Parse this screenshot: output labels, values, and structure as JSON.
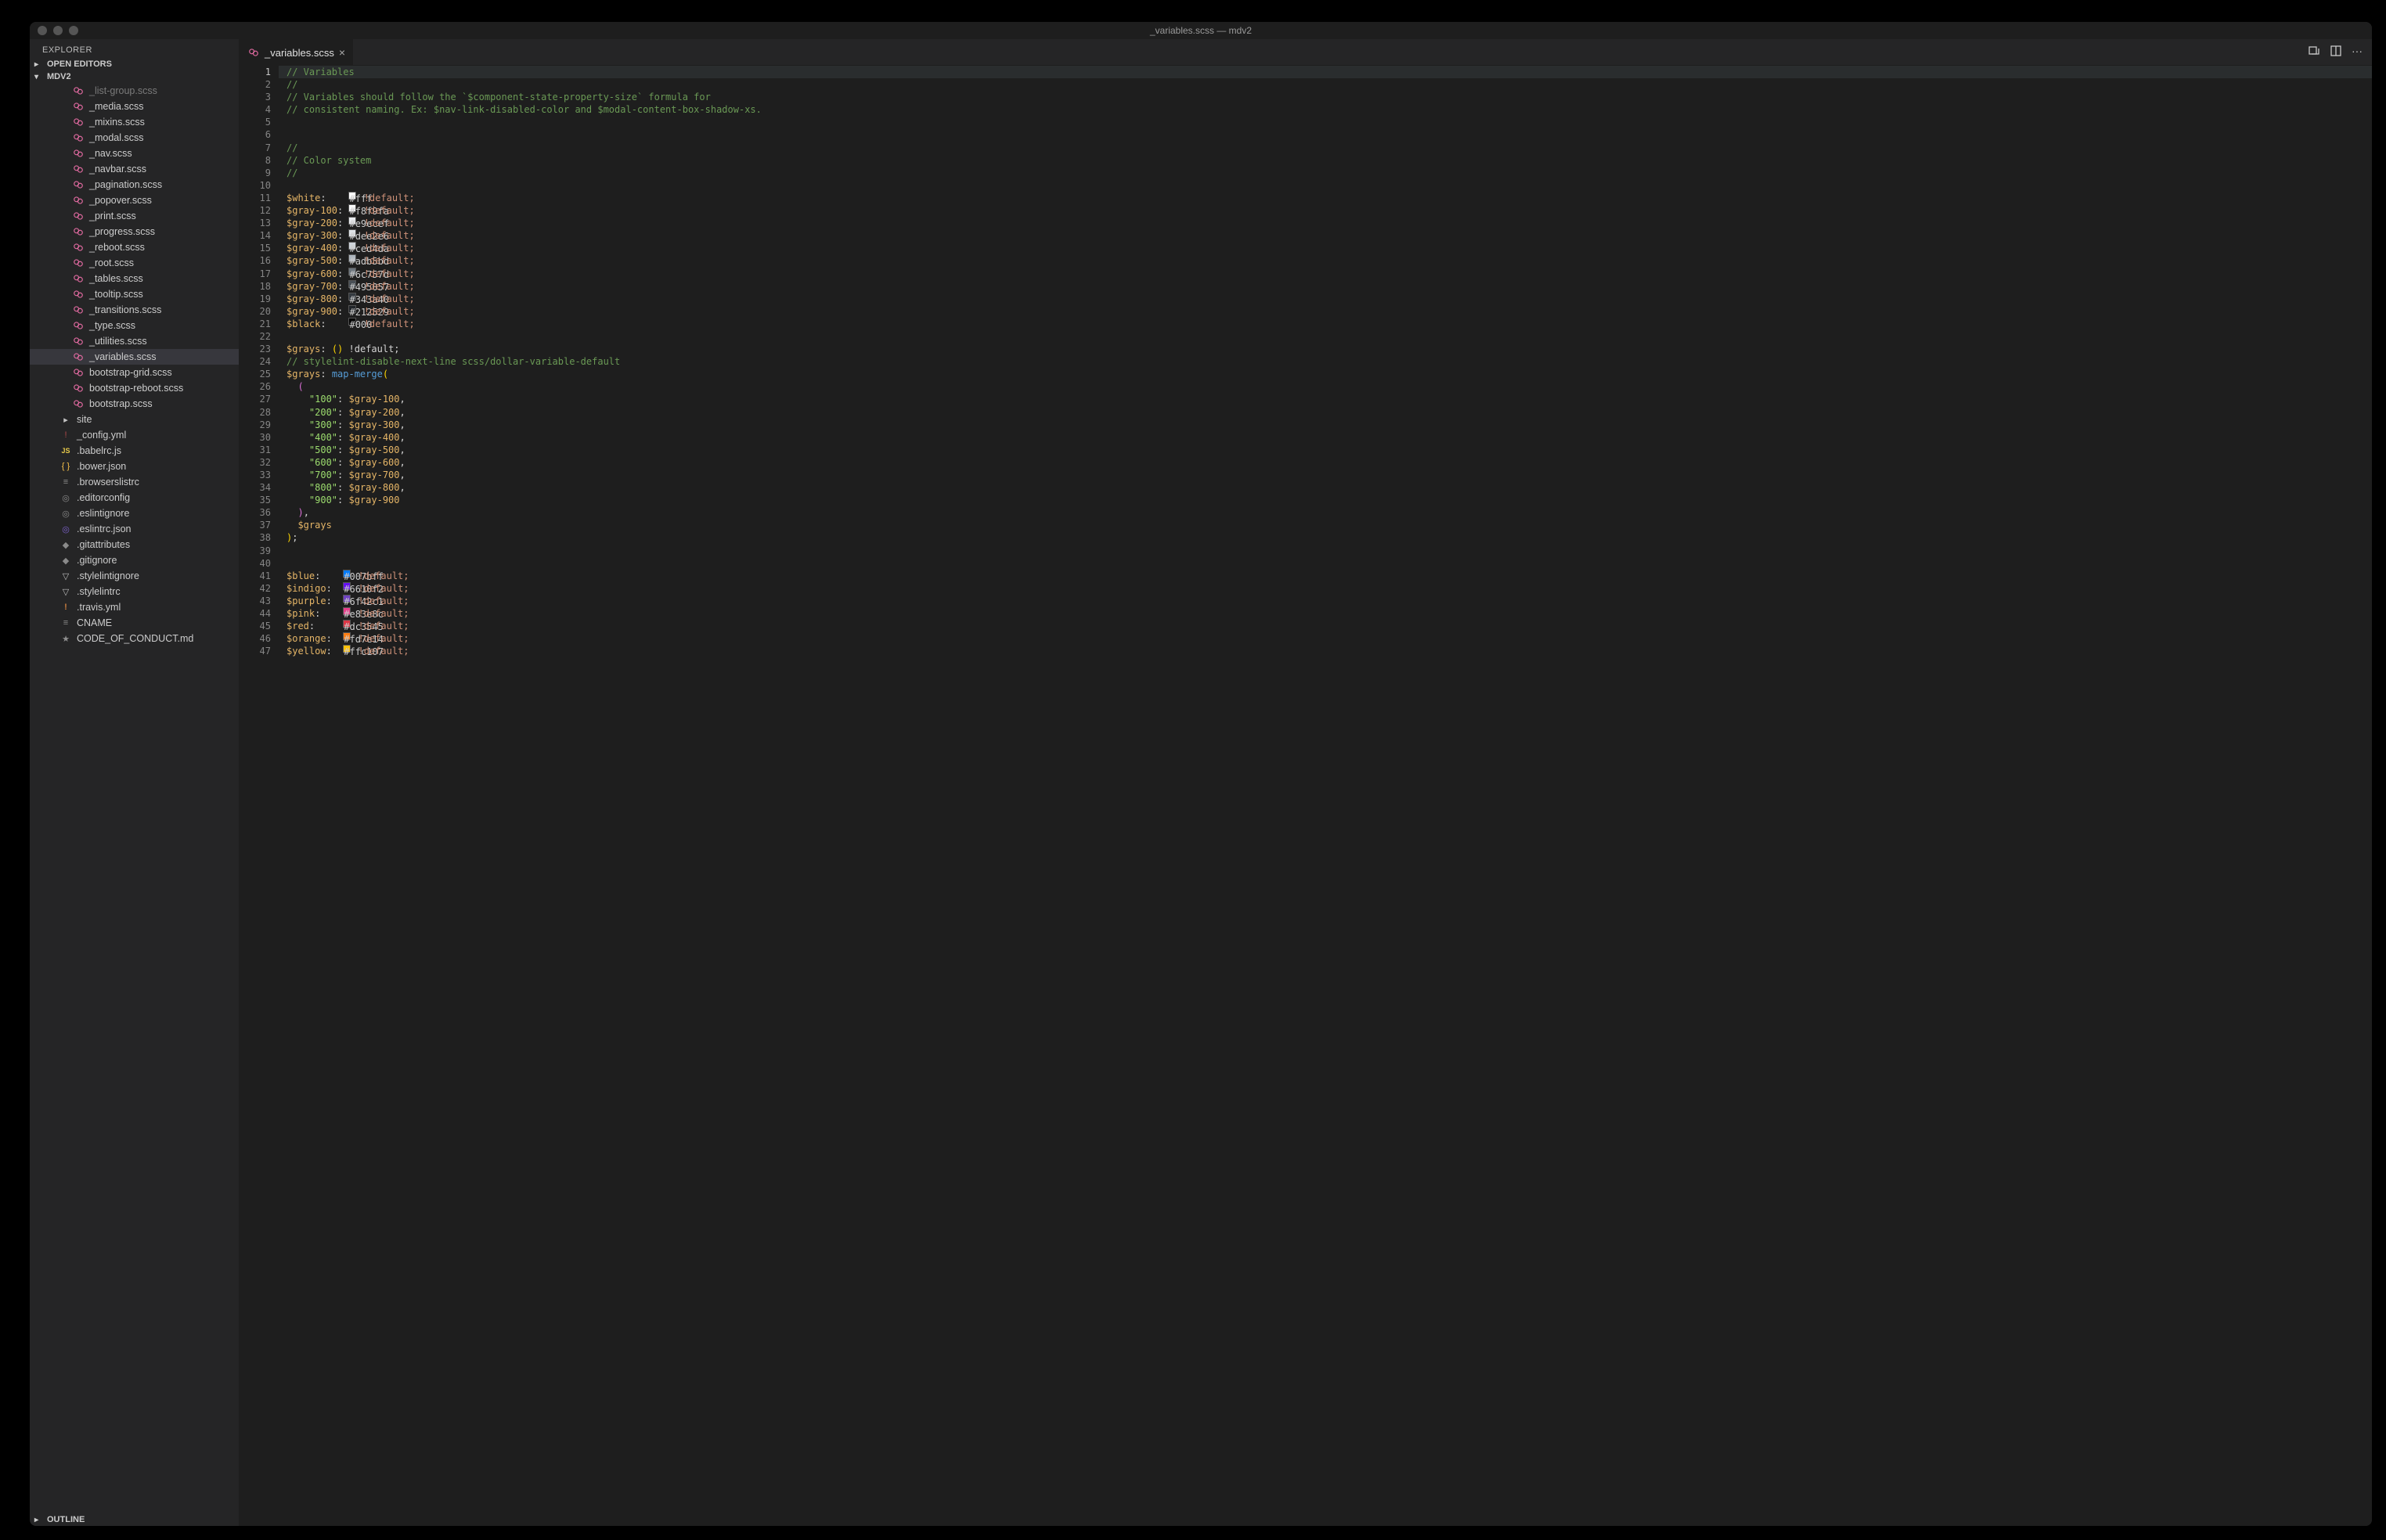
{
  "window_title": "_variables.scss — mdv2",
  "explorer_label": "EXPLORER",
  "sections": {
    "open_editors": "OPEN EDITORS",
    "project": "MDV2",
    "outline": "OUTLINE"
  },
  "open_tab": {
    "label": "_variables.scss",
    "icon": "scss-icon"
  },
  "tabbar_actions": [
    "compare-icon",
    "split-editor-icon",
    "more-icon"
  ],
  "tree": [
    {
      "name": "_list-group.scss",
      "icon": "scss",
      "depth": 2,
      "cut": true
    },
    {
      "name": "_media.scss",
      "icon": "scss",
      "depth": 2
    },
    {
      "name": "_mixins.scss",
      "icon": "scss",
      "depth": 2
    },
    {
      "name": "_modal.scss",
      "icon": "scss",
      "depth": 2
    },
    {
      "name": "_nav.scss",
      "icon": "scss",
      "depth": 2
    },
    {
      "name": "_navbar.scss",
      "icon": "scss",
      "depth": 2
    },
    {
      "name": "_pagination.scss",
      "icon": "scss",
      "depth": 2
    },
    {
      "name": "_popover.scss",
      "icon": "scss",
      "depth": 2
    },
    {
      "name": "_print.scss",
      "icon": "scss",
      "depth": 2
    },
    {
      "name": "_progress.scss",
      "icon": "scss",
      "depth": 2
    },
    {
      "name": "_reboot.scss",
      "icon": "scss",
      "depth": 2
    },
    {
      "name": "_root.scss",
      "icon": "scss",
      "depth": 2
    },
    {
      "name": "_tables.scss",
      "icon": "scss",
      "depth": 2
    },
    {
      "name": "_tooltip.scss",
      "icon": "scss",
      "depth": 2
    },
    {
      "name": "_transitions.scss",
      "icon": "scss",
      "depth": 2
    },
    {
      "name": "_type.scss",
      "icon": "scss",
      "depth": 2
    },
    {
      "name": "_utilities.scss",
      "icon": "scss",
      "depth": 2
    },
    {
      "name": "_variables.scss",
      "icon": "scss",
      "depth": 2,
      "selected": true
    },
    {
      "name": "bootstrap-grid.scss",
      "icon": "scss",
      "depth": 2
    },
    {
      "name": "bootstrap-reboot.scss",
      "icon": "scss",
      "depth": 2
    },
    {
      "name": "bootstrap.scss",
      "icon": "scss",
      "depth": 2
    },
    {
      "name": "site",
      "icon": "folder",
      "depth": 1,
      "chev": "▸"
    },
    {
      "name": "_config.yml",
      "icon": "yml",
      "depth": 1
    },
    {
      "name": ".babelrc.js",
      "icon": "js",
      "depth": 1
    },
    {
      "name": ".bower.json",
      "icon": "json-curly",
      "depth": 1
    },
    {
      "name": ".browserslistrc",
      "icon": "lines",
      "depth": 1
    },
    {
      "name": ".editorconfig",
      "icon": "target",
      "depth": 1
    },
    {
      "name": ".eslintignore",
      "icon": "target",
      "depth": 1
    },
    {
      "name": ".eslintrc.json",
      "icon": "eslint",
      "depth": 1
    },
    {
      "name": ".gitattributes",
      "icon": "diamond",
      "depth": 1
    },
    {
      "name": ".gitignore",
      "icon": "diamond",
      "depth": 1
    },
    {
      "name": ".stylelintignore",
      "icon": "stylelint",
      "depth": 1
    },
    {
      "name": ".stylelintrc",
      "icon": "stylelint",
      "depth": 1
    },
    {
      "name": ".travis.yml",
      "icon": "travis",
      "depth": 1
    },
    {
      "name": "CNAME",
      "icon": "lines",
      "depth": 1
    },
    {
      "name": "CODE_OF_CONDUCT.md",
      "icon": "md",
      "depth": 1
    }
  ],
  "code": {
    "start_line": 1,
    "current_line": 1,
    "lines": [
      {
        "t": "comment",
        "text": "// Variables"
      },
      {
        "t": "comment",
        "text": "//"
      },
      {
        "t": "comment",
        "text": "// Variables should follow the `$component-state-property-size` formula for"
      },
      {
        "t": "comment",
        "text": "// consistent naming. Ex: $nav-link-disabled-color and $modal-content-box-shadow-xs."
      },
      {
        "t": "blank",
        "text": ""
      },
      {
        "t": "blank",
        "text": ""
      },
      {
        "t": "comment",
        "text": "//"
      },
      {
        "t": "comment",
        "text": "// Color system"
      },
      {
        "t": "comment",
        "text": "//"
      },
      {
        "t": "blank",
        "text": ""
      },
      {
        "t": "colorvar",
        "name": "$white",
        "pad": "   ",
        "hex": "#fff",
        "def": " !default;"
      },
      {
        "t": "colorvar",
        "name": "$gray-100",
        "pad": "",
        "hex": "#f8f9fa",
        "def": " !default;"
      },
      {
        "t": "colorvar",
        "name": "$gray-200",
        "pad": "",
        "hex": "#e9ecef",
        "def": " !default;"
      },
      {
        "t": "colorvar",
        "name": "$gray-300",
        "pad": "",
        "hex": "#dee2e6",
        "def": " !default;"
      },
      {
        "t": "colorvar",
        "name": "$gray-400",
        "pad": "",
        "hex": "#ced4da",
        "def": " !default;"
      },
      {
        "t": "colorvar",
        "name": "$gray-500",
        "pad": "",
        "hex": "#adb5bd",
        "def": " !default;"
      },
      {
        "t": "colorvar",
        "name": "$gray-600",
        "pad": "",
        "hex": "#6c757d",
        "def": " !default;"
      },
      {
        "t": "colorvar",
        "name": "$gray-700",
        "pad": "",
        "hex": "#495057",
        "def": " !default;"
      },
      {
        "t": "colorvar",
        "name": "$gray-800",
        "pad": "",
        "hex": "#343a40",
        "def": " !default;"
      },
      {
        "t": "colorvar",
        "name": "$gray-900",
        "pad": "",
        "hex": "#212529",
        "def": " !default;"
      },
      {
        "t": "colorvar",
        "name": "$black",
        "pad": "   ",
        "hex": "#000",
        "def": " !default;"
      },
      {
        "t": "blank",
        "text": ""
      },
      {
        "t": "mapdecl",
        "name": "$grays",
        "after": ": () !default;"
      },
      {
        "t": "comment",
        "text": "// stylelint-disable-next-line scss/dollar-variable-default"
      },
      {
        "t": "mapmerge_open",
        "name": "$grays",
        "func": "map-merge"
      },
      {
        "t": "paren_open",
        "text": "  ("
      },
      {
        "t": "mapentry",
        "key": "\"100\"",
        "val": "$gray-100",
        "comma": ","
      },
      {
        "t": "mapentry",
        "key": "\"200\"",
        "val": "$gray-200",
        "comma": ","
      },
      {
        "t": "mapentry",
        "key": "\"300\"",
        "val": "$gray-300",
        "comma": ","
      },
      {
        "t": "mapentry",
        "key": "\"400\"",
        "val": "$gray-400",
        "comma": ","
      },
      {
        "t": "mapentry",
        "key": "\"500\"",
        "val": "$gray-500",
        "comma": ","
      },
      {
        "t": "mapentry",
        "key": "\"600\"",
        "val": "$gray-600",
        "comma": ","
      },
      {
        "t": "mapentry",
        "key": "\"700\"",
        "val": "$gray-700",
        "comma": ","
      },
      {
        "t": "mapentry",
        "key": "\"800\"",
        "val": "$gray-800",
        "comma": ","
      },
      {
        "t": "mapentry",
        "key": "\"900\"",
        "val": "$gray-900",
        "comma": ""
      },
      {
        "t": "paren_close",
        "text": "  ),"
      },
      {
        "t": "varuse",
        "text": "  $grays"
      },
      {
        "t": "close",
        "text": ");"
      },
      {
        "t": "blank",
        "text": ""
      },
      {
        "t": "blank",
        "text": ""
      },
      {
        "t": "colorvar",
        "name": "$blue",
        "pad": "   ",
        "hex": "#007bff",
        "def": " !default;"
      },
      {
        "t": "colorvar",
        "name": "$indigo",
        "pad": " ",
        "hex": "#6610f2",
        "def": " !default;"
      },
      {
        "t": "colorvar",
        "name": "$purple",
        "pad": " ",
        "hex": "#6f42c1",
        "def": " !default;"
      },
      {
        "t": "colorvar",
        "name": "$pink",
        "pad": "   ",
        "hex": "#e83e8c",
        "def": " !default;"
      },
      {
        "t": "colorvar",
        "name": "$red",
        "pad": "    ",
        "hex": "#dc3545",
        "def": " !default;"
      },
      {
        "t": "colorvar",
        "name": "$orange",
        "pad": " ",
        "hex": "#fd7e14",
        "def": " !default;"
      },
      {
        "t": "colorvar",
        "name": "$yellow",
        "pad": " ",
        "hex": "#ffc107",
        "def": " !default;"
      }
    ]
  }
}
